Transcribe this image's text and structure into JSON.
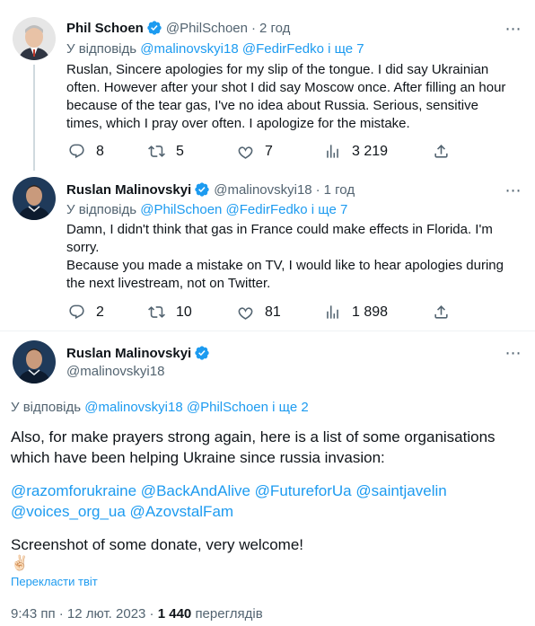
{
  "tweets": [
    {
      "author_name": "Phil Schoen",
      "handle": "@PhilSchoen",
      "dot": "·",
      "time": "2 год",
      "reply_prefix": "У відповідь",
      "reply_targets": "@malinovskyi18 @FedirFedko і ще 7",
      "text_lines": [
        "Ruslan, Sincere apologies for my slip of the tongue. I did say Ukrainian",
        "often. However after your shot I did say Moscow once. After filling an hour",
        "because of the tear gas, I've no idea about Russia. Serious, sensitive",
        "times, which I pray over often. I apologize for the mistake."
      ],
      "replies": "8",
      "retweets": "5",
      "likes": "7",
      "views": "3 219"
    },
    {
      "author_name": "Ruslan Malinovskyi",
      "handle": "@malinovskyi18",
      "dot": "·",
      "time": "1 год",
      "reply_prefix": "У відповідь",
      "reply_targets": "@PhilSchoen @FedirFedko і ще 7",
      "text_lines": [
        "Damn, I didn't think that gas in France could make effects in Florida. I'm",
        "sorry.",
        "Because you made a mistake on TV, I would like to hear apologies during",
        "the next livestream, not on Twitter."
      ],
      "replies": "2",
      "retweets": "10",
      "likes": "81",
      "views": "1 898"
    }
  ],
  "main_tweet": {
    "author_name": "Ruslan Malinovskyi",
    "handle": "@malinovskyi18",
    "reply_prefix": "У відповідь",
    "reply_targets": "@malinovskyi18 @PhilSchoen і ще 2",
    "text_line1": "Also, for make prayers strong again, here is a list of some organisations",
    "text_line2": "which have been helping Ukraine since russia invasion:",
    "mentions_line1": "@razomforukraine @BackAndAlive @FutureforUa @saintjavelin",
    "mentions_line2": "@voices_org_ua @AzovstalFam",
    "closing": "Screenshot of some donate, very welcome!",
    "emoji": "✌🏻",
    "translate": "Перекласти твіт",
    "timestamp": "9:43 пп · 12 лют. 2023 ·",
    "views_count": "1 440",
    "views_label": "переглядів"
  },
  "colors": {
    "accent": "#1d9bf0",
    "muted": "#536471",
    "text": "#0f1419",
    "verified": "#1d9bf0"
  },
  "icons": {
    "verified": "verified-badge-icon",
    "reply": "reply-icon",
    "retweet": "retweet-icon",
    "like": "heart-icon",
    "views": "views-chart-icon",
    "share": "share-icon",
    "more": "more-icon"
  }
}
